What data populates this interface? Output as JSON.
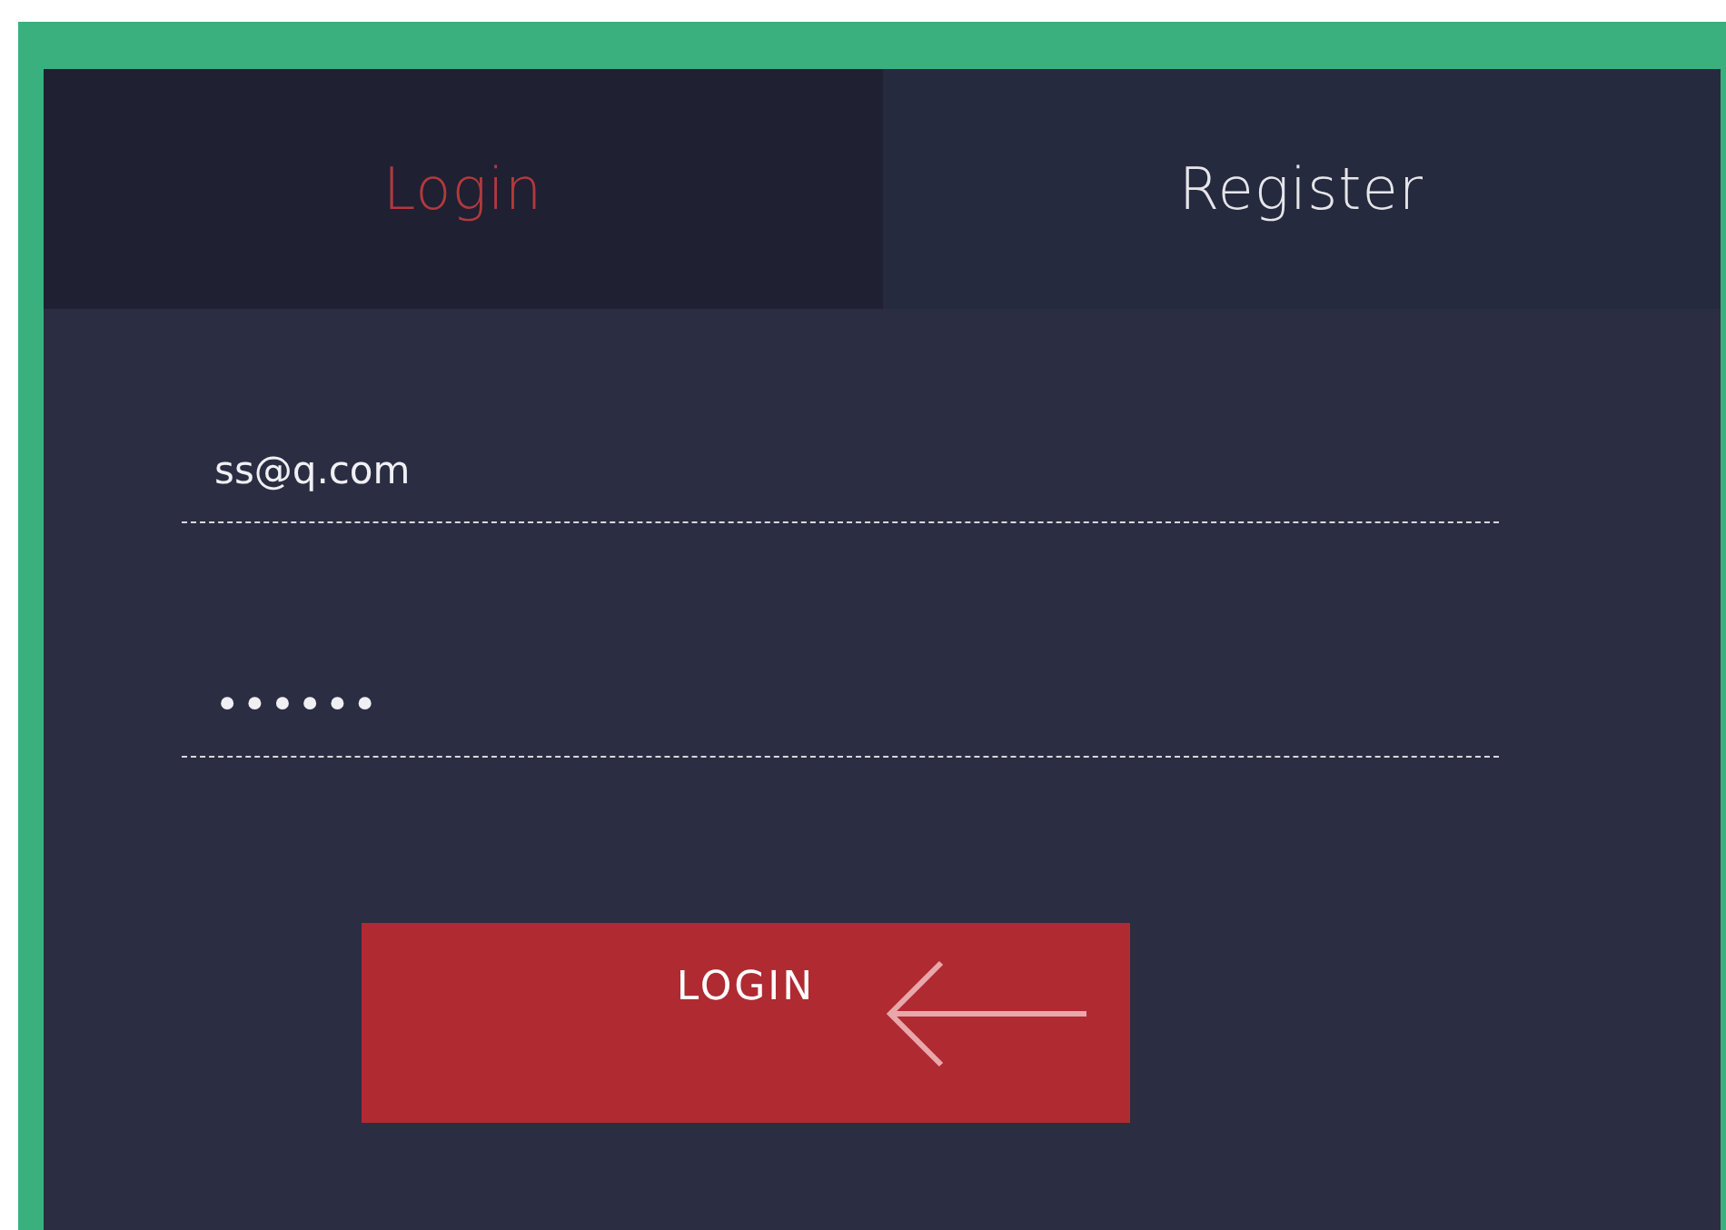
{
  "tabs": [
    {
      "label": "Login",
      "selected": true
    },
    {
      "label": "Register",
      "selected": false
    }
  ],
  "form": {
    "fields": [
      {
        "kind": "email",
        "value": "ss@q.com"
      },
      {
        "kind": "password",
        "value": "••••••"
      }
    ],
    "submit": {
      "label": "LOGIN"
    }
  }
}
